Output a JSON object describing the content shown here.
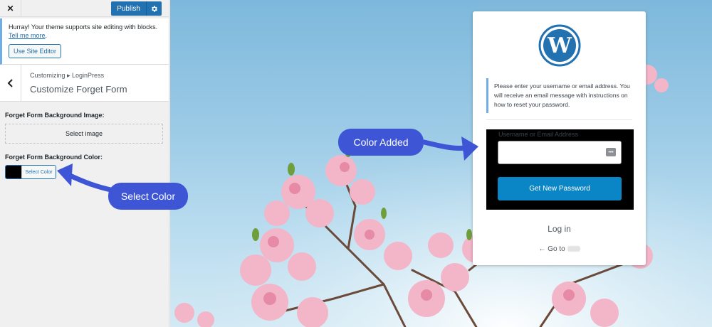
{
  "topbar": {
    "close_glyph": "✕",
    "publish_label": "Publish",
    "gear_icon": "gear-icon"
  },
  "notice": {
    "text": "Hurray! Your theme supports site editing with blocks.",
    "link_text": "Tell me more",
    "link_suffix": ".",
    "button_label": "Use Site Editor"
  },
  "section": {
    "breadcrumb": "Customizing ▸ LoginPress",
    "title": "Customize Forget Form"
  },
  "fields": {
    "bg_image_label": "Forget Form Background Image:",
    "select_image": "Select image",
    "bg_color_label": "Forget Form Background Color:",
    "select_color": "Select Color",
    "selected_color": "#000000"
  },
  "login_card": {
    "message": "Please enter your username or email address. You will receive an email message with instructions on how to reset your password.",
    "input_label": "Username or Email Address",
    "input_value": "",
    "submit_label": "Get New Password",
    "login_link": "Log in",
    "goto_prefix": "← Go to",
    "form_bg_color": "#000000"
  },
  "callouts": {
    "select_color": "Select Color",
    "color_added": "Color Added"
  },
  "colors": {
    "accent": "#2271b1",
    "callout": "#3e56d6",
    "button": "#0a85c6"
  }
}
